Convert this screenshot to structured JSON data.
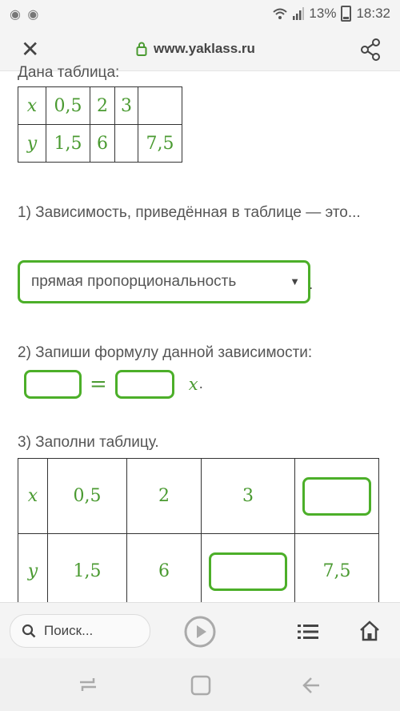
{
  "status": {
    "left_icons": "◉ ◉",
    "battery": "13%",
    "time": "18:32"
  },
  "browser": {
    "url": "www.yaklass.ru"
  },
  "task": {
    "intro": "Дана таблица:",
    "table1": {
      "row_x": [
        "x",
        "0,5",
        "2",
        "3",
        ""
      ],
      "row_y": [
        "y",
        "1,5",
        "6",
        "",
        "7,5"
      ]
    },
    "q1": {
      "text": "1) Зависимость, приведённая в таблице — это...",
      "selected": "прямая пропорциональность",
      "trailing": "."
    },
    "q2": {
      "text": "2) Запиши формулу данной зависимости:",
      "eq": "=",
      "var": "x",
      "dot": "."
    },
    "q3": {
      "text": "3) Заполни таблицу.",
      "row_x": [
        "x",
        "0,5",
        "2",
        "3",
        ""
      ],
      "row_y": [
        "y",
        "1,5",
        "6",
        "",
        "7,5"
      ]
    }
  },
  "bottom": {
    "search_label": "Поиск..."
  }
}
